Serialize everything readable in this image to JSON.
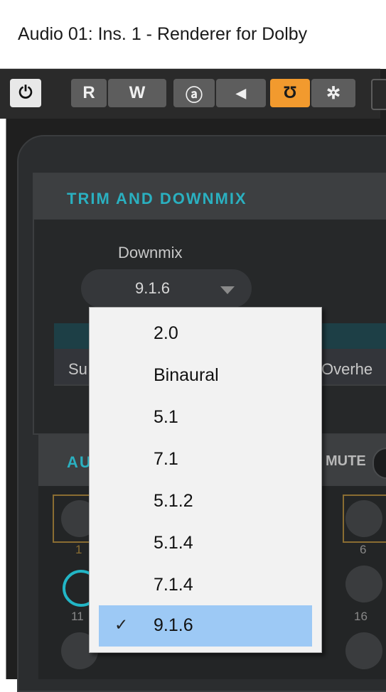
{
  "window": {
    "title": "Audio 01: Ins. 1 - Renderer for Dolby"
  },
  "toolbar": {
    "buttons": [
      {
        "icon": "power-icon",
        "glyph": "⏻"
      },
      {
        "label": "R"
      },
      {
        "label": "W"
      },
      {
        "icon": "a-icon",
        "glyph": "ⓐ"
      },
      {
        "icon": "arrow-left-icon",
        "glyph": "◀"
      },
      {
        "icon": "routing-icon",
        "glyph": "Ʊ"
      },
      {
        "icon": "gear-icon",
        "glyph": "✲"
      }
    ]
  },
  "trim_panel": {
    "title": "TRIM AND DOWNMIX",
    "downmix_label": "Downmix",
    "downmix_value": "9.1.6",
    "sub_left": "Su",
    "sub_right": "Overhe"
  },
  "audio_panel": {
    "title": "AU",
    "mute_label": "MUTE",
    "channel_numbers": [
      "1",
      "6",
      "11",
      "16"
    ]
  },
  "dropdown": {
    "options": [
      "2.0",
      "Binaural",
      "5.1",
      "7.1",
      "5.1.2",
      "5.1.4",
      "7.1.4",
      "9.1.6"
    ],
    "selected": "9.1.6",
    "check_glyph": "✓"
  },
  "colors": {
    "accent_teal": "#2ab0c0",
    "toolbar_active_orange": "#f29a2e",
    "selection_blue": "#9dc9f5"
  }
}
